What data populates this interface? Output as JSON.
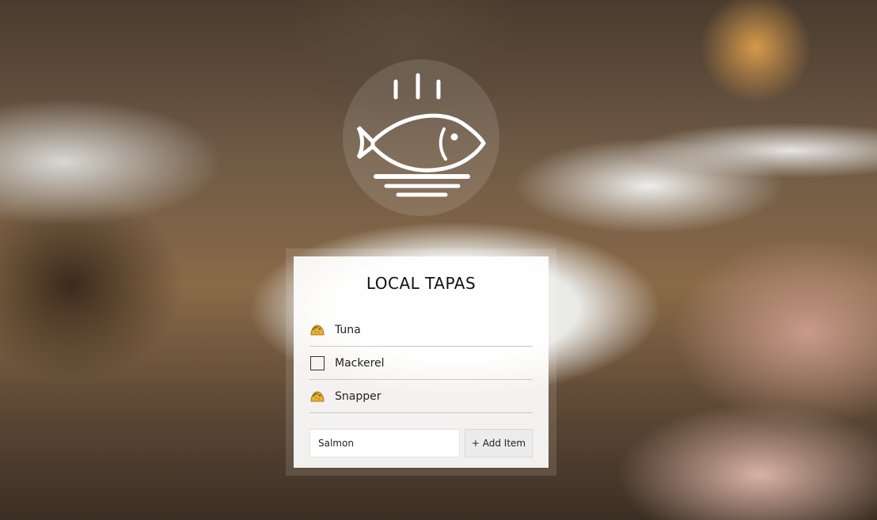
{
  "app": {
    "title": "LOCAL TAPAS"
  },
  "list": {
    "items": [
      {
        "label": "Tuna",
        "done": true,
        "icon": "taco-icon"
      },
      {
        "label": "Mackerel",
        "done": false,
        "icon": "empty-checkbox-icon"
      },
      {
        "label": "Snapper",
        "done": true,
        "icon": "taco-icon"
      }
    ]
  },
  "form": {
    "input_value": "Salmon",
    "add_label": "+ Add Item"
  },
  "logo": {
    "icon": "steaming-fish-plate-icon"
  },
  "colors": {
    "card_bg": "#ffffff",
    "divider": "#c9c9c9",
    "button_bg": "#ececec",
    "taco_shell": "#e9b22e",
    "taco_filling": "#5c8a2e"
  }
}
